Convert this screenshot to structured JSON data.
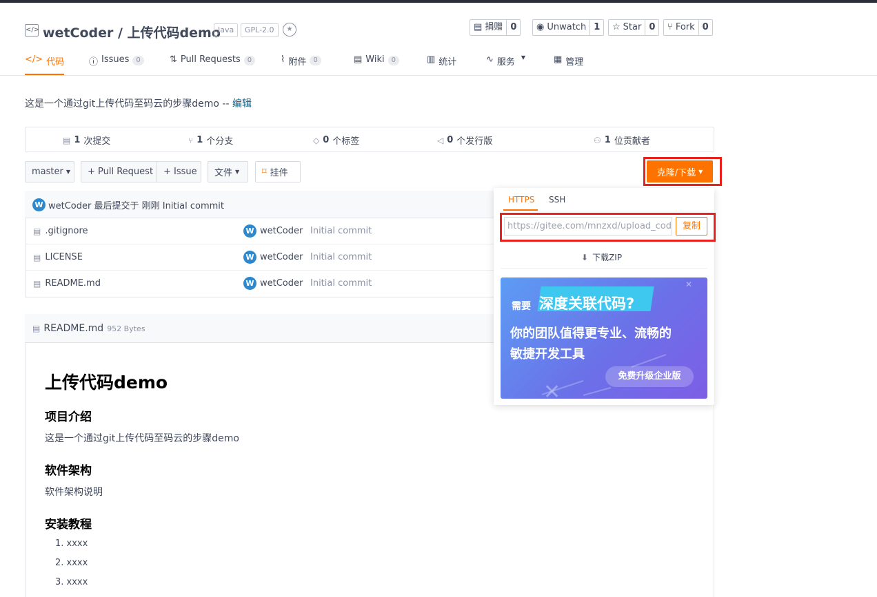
{
  "repo": {
    "title": "wetCoder / 上传代码demo",
    "tags": [
      "Java",
      "GPL-2.0"
    ]
  },
  "actions": [
    {
      "icon": "donate-icon",
      "label": "捐赠",
      "count": "0"
    },
    {
      "icon": "eye-icon",
      "label": "Unwatch",
      "count": "1"
    },
    {
      "icon": "star-icon",
      "label": "Star",
      "count": "0"
    },
    {
      "icon": "fork-icon",
      "label": "Fork",
      "count": "0"
    }
  ],
  "tabs": [
    {
      "label": "代码",
      "badge": "",
      "active": true
    },
    {
      "label": "Issues",
      "badge": "0"
    },
    {
      "label": "Pull Requests",
      "badge": "0"
    },
    {
      "label": "附件",
      "badge": "0"
    },
    {
      "label": "Wiki",
      "badge": "0"
    },
    {
      "label": "统计",
      "badge": ""
    },
    {
      "label": "服务",
      "badge": ""
    },
    {
      "label": "管理",
      "badge": ""
    }
  ],
  "description": {
    "text": "这是一个通过git上传代码至码云的步骤demo --",
    "edit": "编辑"
  },
  "stats": [
    {
      "value": "1",
      "label": "次提交"
    },
    {
      "value": "1",
      "label": "个分支"
    },
    {
      "value": "0",
      "label": "个标签"
    },
    {
      "value": "0",
      "label": "个发行版"
    },
    {
      "value": "1",
      "label": "位贡献者"
    }
  ],
  "toolbar": {
    "branch": "master",
    "pull_request": "+ Pull Request",
    "issue": "+ Issue",
    "file": "文件",
    "widget": "挂件",
    "clone": "克隆/下载"
  },
  "latest_commit": {
    "avatar": "W",
    "text": "wetCoder 最后提交于 刚刚 Initial commit"
  },
  "files": [
    {
      "name": ".gitignore",
      "author": "wetCoder",
      "message": "Initial commit"
    },
    {
      "name": "LICENSE",
      "author": "wetCoder",
      "message": "Initial commit"
    },
    {
      "name": "README.md",
      "author": "wetCoder",
      "message": "Initial commit"
    }
  ],
  "readme": {
    "filename": "README.md",
    "size": "952 Bytes",
    "h1": "上传代码demo",
    "sec1_title": "项目介绍",
    "sec1_text": "这是一个通过git上传代码至码云的步骤demo",
    "sec2_title": "软件架构",
    "sec2_text": "软件架构说明",
    "sec3_title": "安装教程",
    "list": [
      "1. xxxx",
      "2. xxxx",
      "3. xxxx"
    ]
  },
  "clone_dropdown": {
    "tab_https": "HTTPS",
    "tab_ssh": "SSH",
    "url": "https://gitee.com/mnzxd/upload_code_",
    "copy": "复制",
    "download": "下载ZIP",
    "ad": {
      "prefix": "需要",
      "highlight": "深度关联代码?",
      "line1": "你的团队值得更专业、流畅的",
      "line2": "敏捷开发工具",
      "button": "免费升级企业版"
    }
  },
  "colors": {
    "accent": "#fe7300",
    "highlight_box": "#e8211c",
    "link": "#005980"
  }
}
